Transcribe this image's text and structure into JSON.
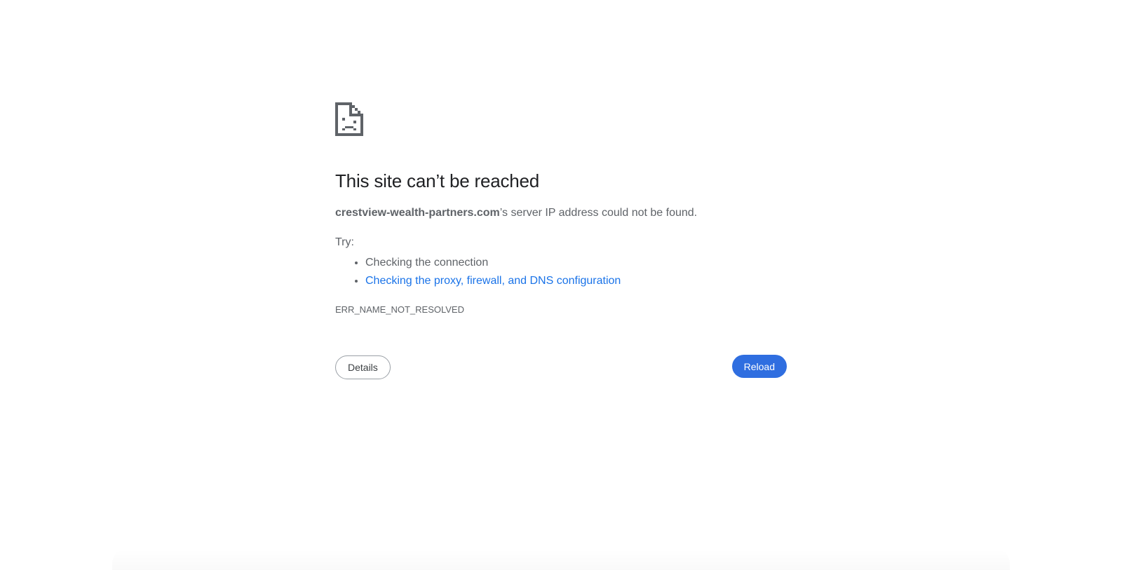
{
  "error_page": {
    "icon": "sad-page-icon",
    "heading": "This site can’t be reached",
    "domain": "crestview-wealth-partners.com",
    "summary_suffix": "’s server IP address could not be found.",
    "try_label": "Try:",
    "suggestions": [
      {
        "text": "Checking the connection",
        "is_link": false
      },
      {
        "text": "Checking the proxy, firewall, and DNS configuration",
        "is_link": true
      }
    ],
    "error_code": "ERR_NAME_NOT_RESOLVED"
  },
  "buttons": {
    "details_label": "Details",
    "reload_label": "Reload"
  },
  "colors": {
    "heading": "#202124",
    "body_text": "#5f6368",
    "link": "#1a73e8",
    "primary_button": "#2f6ee0",
    "icon": "#5f6368"
  }
}
